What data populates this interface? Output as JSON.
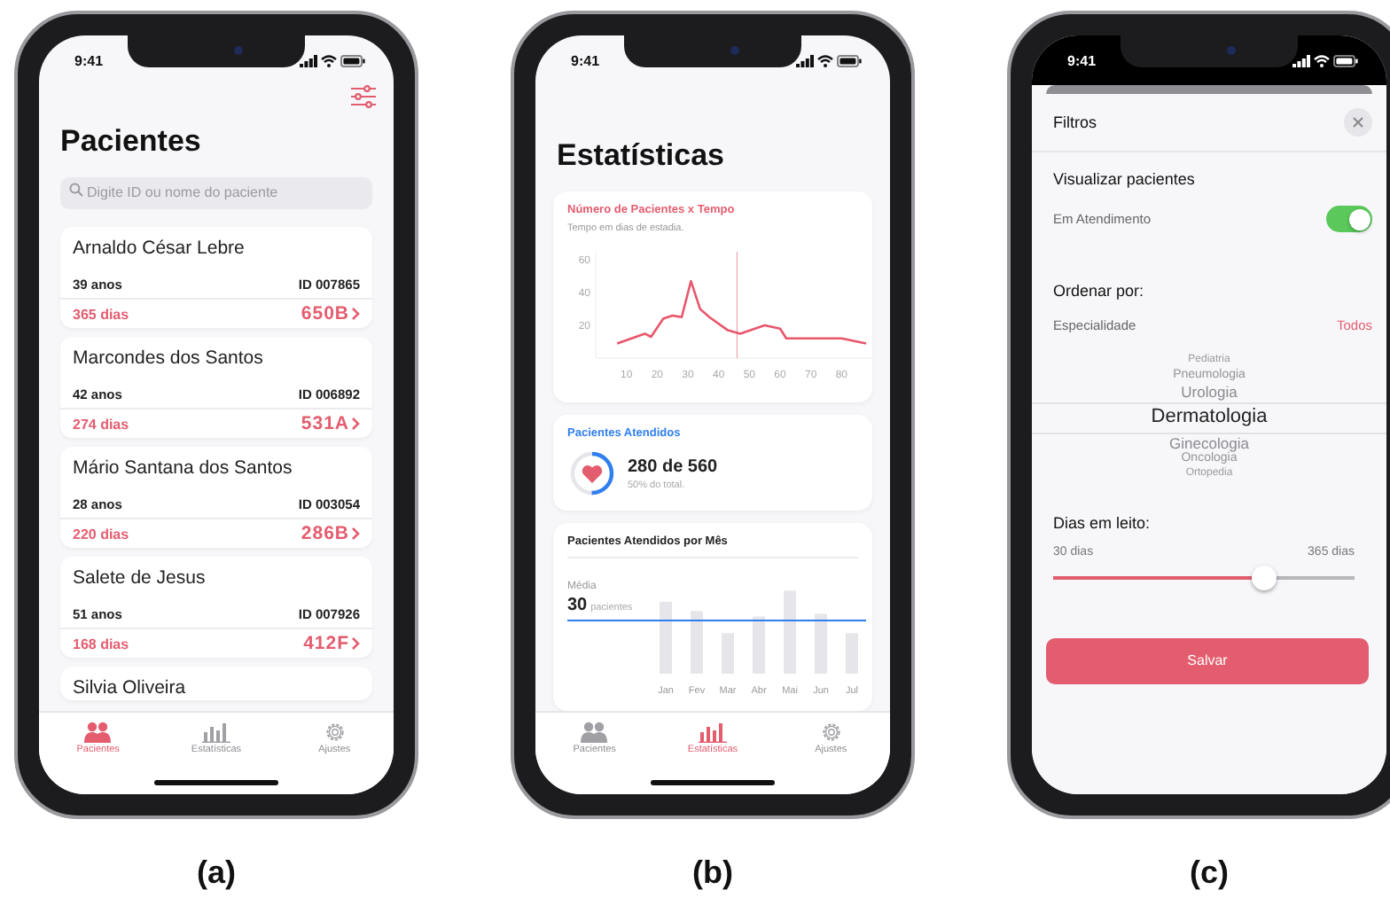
{
  "panels": [
    {
      "caption": "(a)",
      "screen": {
        "kind": "patients",
        "time": "9:41",
        "title": "Pacientes",
        "search": {
          "placeholder": "Digite ID ou nome do paciente"
        },
        "patients": [
          {
            "name": "Arnaldo César Lebre",
            "age": "39 anos",
            "id": "ID 007865",
            "days": "365 dias",
            "bed": "650B"
          },
          {
            "name": "Marcondes dos Santos",
            "age": "42 anos",
            "id": "ID 006892",
            "days": "274 dias",
            "bed": "531A"
          },
          {
            "name": "Mário Santana dos Santos",
            "age": "28 anos",
            "id": "ID 003054",
            "days": "220 dias",
            "bed": "286B"
          },
          {
            "name": "Salete de Jesus",
            "age": "51 anos",
            "id": "ID 007926",
            "days": "168 dias",
            "bed": "412F"
          },
          {
            "name": "Silvia Oliveira"
          }
        ],
        "tabs": [
          {
            "label": "Pacientes",
            "selected": true
          },
          {
            "label": "Estatísticas",
            "selected": false
          },
          {
            "label": "Ajustes",
            "selected": false
          }
        ]
      }
    },
    {
      "caption": "(b)",
      "screen": {
        "kind": "statistics",
        "time": "9:41",
        "title": "Estatísticas",
        "line_card": {
          "subtitle": "Tempo em dias de estadia.",
          "chart_data": {
            "type": "line",
            "title": "Número de Pacientes x Tempo",
            "xlim": [
              0,
              90
            ],
            "ylim": [
              0,
              65
            ],
            "xticks": [
              10,
              20,
              30,
              40,
              50,
              60,
              70,
              80
            ],
            "yticks": [
              20,
              40,
              60
            ],
            "series": [
              {
                "color": "#e8566c",
                "x": [
                  7,
                  16,
                  18,
                  22,
                  25,
                  28,
                  31,
                  34,
                  37,
                  43,
                  47,
                  55,
                  60,
                  62,
                  72,
                  80,
                  88
                ],
                "values": [
                  9,
                  15,
                  13,
                  24,
                  26,
                  25,
                  47,
                  30,
                  25,
                  17,
                  15,
                  20,
                  18,
                  12,
                  12,
                  12,
                  9
                ]
              }
            ],
            "ref_lines": [
              {
                "axis": "x",
                "value": 46,
                "color": "#f0a0ac"
              }
            ]
          }
        },
        "attended": {
          "title": "Pacientes Atendidos",
          "value": "280 de 560",
          "note": "50% do total.",
          "level": 0.5
        },
        "monthly": {
          "title": "Pacientes Atendidos por Mês",
          "mean_label": "Média",
          "mean_value": "30",
          "mean_unit": "pacientes",
          "months": [
            "Jan",
            "Fev",
            "Mar",
            "Abr",
            "Mai",
            "Jun",
            "Jul"
          ]
        },
        "tabs": [
          {
            "label": "Pacientes",
            "selected": false
          },
          {
            "label": "Estatísticas",
            "selected": true
          },
          {
            "label": "Ajustes",
            "selected": false
          }
        ]
      }
    },
    {
      "caption": "(c)",
      "screen": {
        "kind": "filters",
        "time": "9:41",
        "title": "Filtros",
        "view_section": "Visualizar pacientes",
        "toggle": {
          "label": "Em Atendimento",
          "on": true
        },
        "sort_section": "Ordenar por:",
        "sort_row": {
          "label": "Especialidade",
          "value": "Todos"
        },
        "picker": [
          {
            "label": "Pediatria",
            "selected": false
          },
          {
            "label": "Pneumologia",
            "selected": false
          },
          {
            "label": "Urologia",
            "selected": false
          },
          {
            "label": "Dermatologia",
            "selected": true
          },
          {
            "label": "Ginecologia",
            "selected": false
          },
          {
            "label": "Oncologia",
            "selected": false
          },
          {
            "label": "Ortopedia",
            "selected": false
          }
        ],
        "days_section": "Dias em leito:",
        "slider": {
          "min_label": "30 dias",
          "max_label": "365 dias",
          "level": 0.7
        },
        "save": "Salvar"
      }
    }
  ]
}
